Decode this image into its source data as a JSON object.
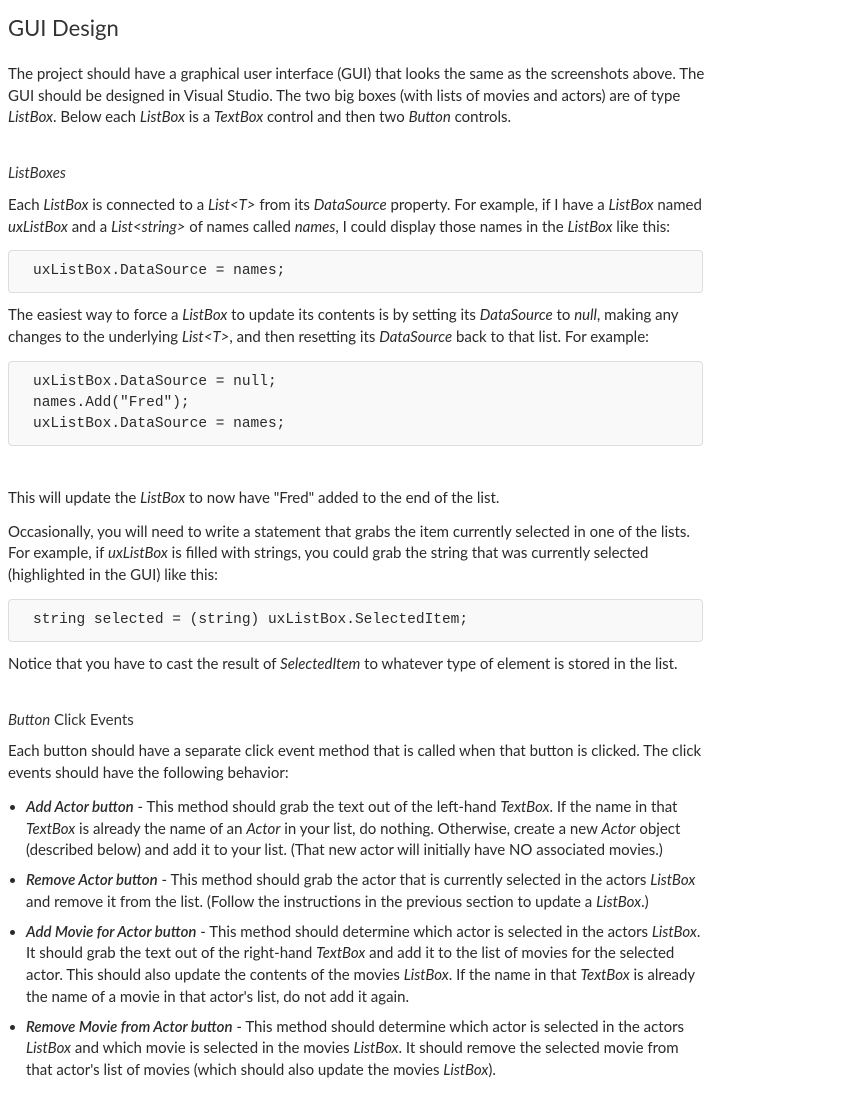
{
  "title": "GUI Design",
  "para_intro_1": "The project should have a graphical user interface (GUI) that looks the same as the screenshots above. The GUI should be designed in Visual Studio. The two big boxes (with lists of movies and actors) are of type ",
  "para_intro_2": ". Below each ",
  "para_intro_3": " is a ",
  "para_intro_4": " control and then two ",
  "para_intro_5": " controls.",
  "term_listbox": "ListBox",
  "term_textbox": "TextBox",
  "term_button": "Button",
  "h_listboxes": "ListBoxes",
  "lb_p1a": "Each ",
  "lb_p1b": " is connected to a ",
  "term_listT": "List<T>",
  "lb_p1c": " from its ",
  "term_datasource": "DataSource",
  "lb_p1d": " property. For example, if I have a ",
  "lb_p1e": " named ",
  "term_uxlistbox": "uxListBox",
  "lb_p1f": " and a ",
  "term_liststring": "List<string>",
  "lb_p1g": " of names called ",
  "term_names": "names",
  "lb_p1h": ", I could display those names in the ",
  "lb_p1i": " like this:",
  "code1": "uxListBox.DataSource = names;",
  "lb_p2a": "The easiest way to force a ",
  "lb_p2b": " to update its contents is by setting its ",
  "lb_p2c": " to ",
  "term_null": "null",
  "lb_p2d": ", making any changes to the underlying ",
  "lb_p2e": ", and then resetting its ",
  "lb_p2f": " back to that list. For example:",
  "code2": "uxListBox.DataSource = null;\nnames.Add(\"Fred\");\nuxListBox.DataSource = names;",
  "lb_p3a": "This will update the ",
  "lb_p3b": " to now have \"Fred\" added to the end of the list.",
  "lb_p4a": "Occasionally, you will need to write a statement that grabs the item currently selected in one of the lists. For example, if ",
  "lb_p4b": " is filled with strings, you could grab the string that was currently selected (highlighted in the GUI) like this:",
  "code3": "string selected = (string) uxListBox.SelectedItem;",
  "lb_p5a": "Notice that you have to cast the result of ",
  "term_selecteditem": "SelectedItem",
  "lb_p5b": " to whatever type of element is stored in the list.",
  "h_button_events_1": "Button",
  "h_button_events_2": " Click Events",
  "be_p1": "Each button should have a separate click event method that is called when that button is clicked. The click events should have the following behavior:",
  "li1_t": "Add Actor button",
  "li1_a": " - This method should grab the text out of the left-hand ",
  "li1_b": ". If the name in that ",
  "li1_c": " is already the name of an ",
  "term_actor": "Actor",
  "li1_d": " in your list, do nothing. Otherwise, create a new ",
  "li1_e": " object (described below) and add it to your list. (That new actor will initially have NO associated movies.)",
  "li2_t": "Remove Actor button",
  "li2_a": " - This method should grab the actor that is currently selected in the actors ",
  "li2_b": " and remove it from the list. (Follow the instructions in the previous section to update a ",
  "li2_c": ".)",
  "li3_t": "Add Movie for Actor button",
  "li3_a": " - This method should determine which actor is selected in the actors ",
  "li3_b": ". It should grab the text out of the right-hand ",
  "li3_c": " and add it to the list of movies for the selected actor. This should also update the contents of the movies ",
  "li3_d": ". If the name in that ",
  "li3_e": " is already the name of a movie in that actor's list, do not add it again.",
  "li4_t": "Remove Movie from Actor button",
  "li4_a": " - This method should determine which actor is selected in the actors ",
  "li4_b": " and which movie is selected in the movies ",
  "li4_c": ". It should remove the selected movie from that actor's list of movies (which should also update the movies ",
  "li4_d": ")."
}
